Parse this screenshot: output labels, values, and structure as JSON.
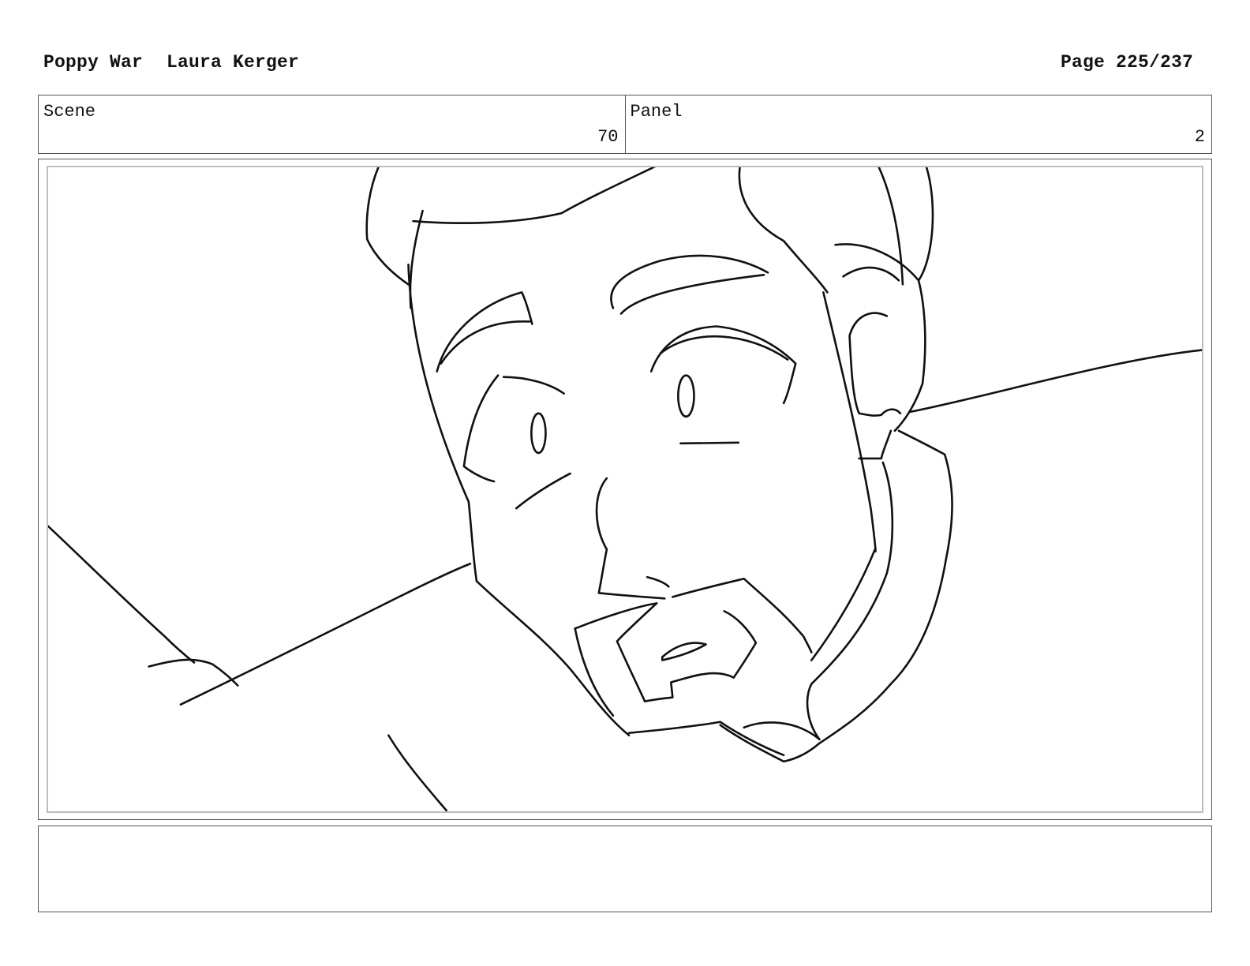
{
  "header": {
    "project": "Poppy War",
    "author": "Laura Kerger",
    "page": "Page 225/237"
  },
  "scene": {
    "label": "Scene",
    "value": "70"
  },
  "panel": {
    "label": "Panel",
    "value": "2"
  },
  "notes": {
    "text": ""
  },
  "image": {
    "icon": "storyboard-sketch-man-face-closeup"
  }
}
